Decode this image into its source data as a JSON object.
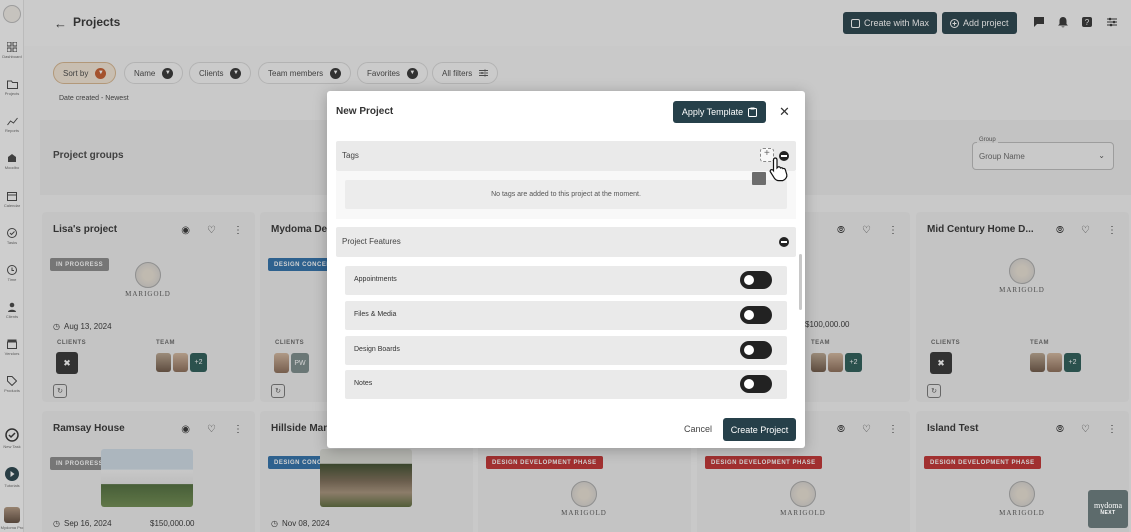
{
  "sidebar": {
    "items": [
      {
        "label": "Dashboard",
        "icon": "dashboard-icon"
      },
      {
        "label": "Projects",
        "icon": "folder-icon"
      },
      {
        "label": "Reports",
        "icon": "chart-icon"
      },
      {
        "label": "Moodbo",
        "icon": "building-icon"
      },
      {
        "label": "Calendar",
        "icon": "calendar-icon"
      },
      {
        "label": "Tasks",
        "icon": "check-icon"
      },
      {
        "label": "Time",
        "icon": "clock-icon"
      },
      {
        "label": "Clients",
        "icon": "person-icon"
      },
      {
        "label": "Vendors",
        "icon": "store-icon"
      },
      {
        "label": "Products",
        "icon": "tag-icon"
      },
      {
        "label": "New Task",
        "icon": "task-add-icon"
      },
      {
        "label": "Tutorials",
        "icon": "play-icon"
      },
      {
        "label": "Mydoma Pro",
        "icon": "avatar"
      }
    ]
  },
  "header": {
    "title": "Projects",
    "create_with_max": "Create with Max",
    "add_project": "Add project"
  },
  "filters": {
    "sort_by": "Sort by",
    "name": "Name",
    "clients": "Clients",
    "team_members": "Team members",
    "favorites": "Favorites",
    "all_filters": "All filters",
    "date_created": "Date created - Newest"
  },
  "groups": {
    "title": "Project groups",
    "legend": "Group",
    "value": "Group Name"
  },
  "cards": [
    {
      "name": "Lisa's project",
      "badge": "IN PROGRESS",
      "date": "Aug 13, 2024",
      "clients_label": "CLIENTS",
      "team_label": "TEAM",
      "team_extra": "+2"
    },
    {
      "name": "Mydoma De",
      "badge": "DESIGN CONCEPT PHASE",
      "clients_label": "CLIENTS",
      "client_initials": "PW"
    },
    {
      "value": "$100,000.00",
      "team_label": "TEAM",
      "team_extra": "+2"
    },
    {
      "name": "Mid Century Home D...",
      "clients_label": "CLIENTS",
      "team_label": "TEAM",
      "team_extra": "+2"
    },
    {
      "name": "Ramsay House",
      "badge": "IN PROGRESS",
      "date": "Sep 16, 2024",
      "value": "$150,000.00"
    },
    {
      "name": "Hillside Man",
      "badge": "DESIGN CONCEPT PHASE",
      "date": "Nov 08, 2024"
    },
    {
      "badge": "DESIGN DEVELOPMENT PHASE"
    },
    {
      "badge": "DESIGN DEVELOPMENT PHASE"
    },
    {
      "name": "Island Test",
      "badge": "DESIGN DEVELOPMENT PHASE"
    }
  ],
  "logo_text": "MARIGOLD",
  "modal": {
    "title": "New Project",
    "apply_template": "Apply Template",
    "tags": {
      "title": "Tags",
      "empty": "No tags are added to this project at the moment."
    },
    "features": {
      "title": "Project Features",
      "items": [
        "Appointments",
        "Files & Media",
        "Design Boards",
        "Notes"
      ]
    },
    "cancel": "Cancel",
    "create": "Create Project"
  },
  "watermark": {
    "line1": "mydoma",
    "line2": "NEXT"
  },
  "colors": {
    "primary": "#26404a",
    "badge_red": "#c03030",
    "badge_blue": "#2e6fa8",
    "sort_accent": "#c55b2c"
  }
}
